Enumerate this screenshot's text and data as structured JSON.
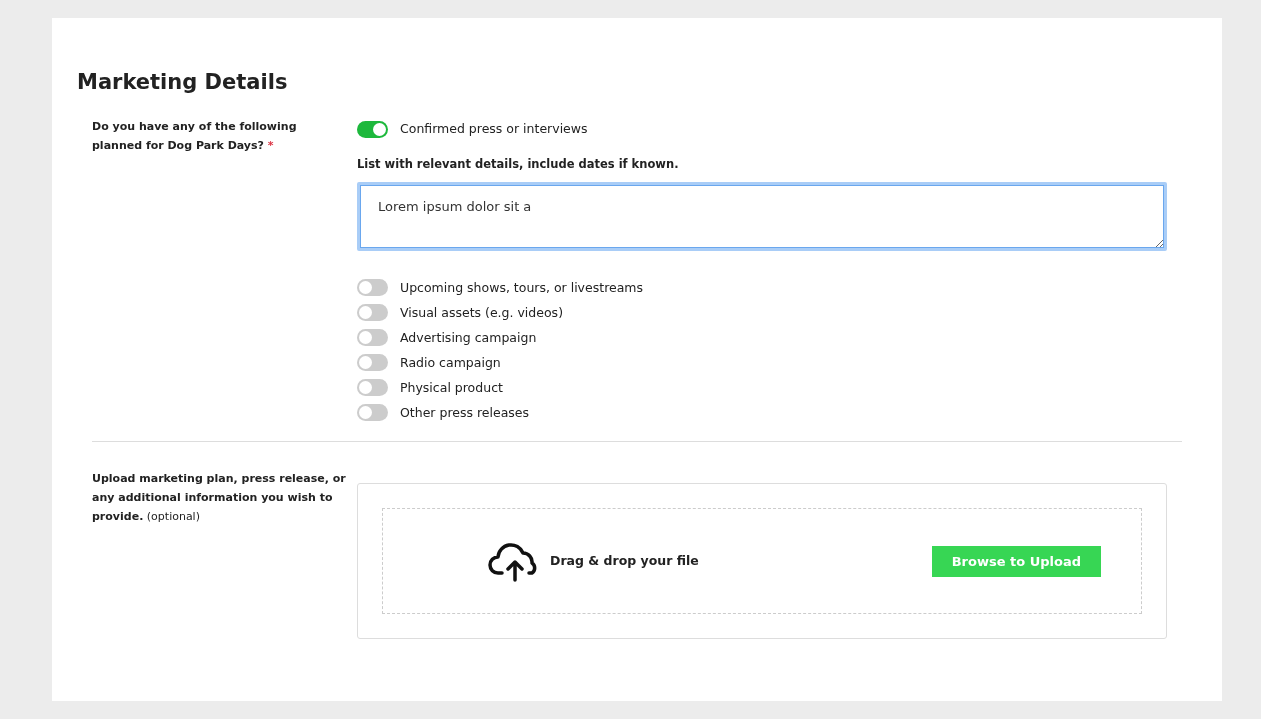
{
  "title": "Marketing Details",
  "question": {
    "label": "Do you have any of the following planned for Dog Park Days?",
    "required_mark": "*",
    "options": [
      {
        "label": "Confirmed press or interviews",
        "on": true,
        "details": {
          "label": "List with relevant details, include dates if known.",
          "value": "Lorem ipsum dolor sit a"
        }
      },
      {
        "label": "Upcoming shows, tours, or livestreams",
        "on": false
      },
      {
        "label": "Visual assets (e.g. videos)",
        "on": false
      },
      {
        "label": "Advertising campaign",
        "on": false
      },
      {
        "label": "Radio campaign",
        "on": false
      },
      {
        "label": "Physical product",
        "on": false
      },
      {
        "label": "Other press releases",
        "on": false
      }
    ]
  },
  "upload": {
    "label": "**Upload marketing plan, press release, or any additional information you wish to provide.** (optional)",
    "drop_text": "Drag & drop your file",
    "button": "Browse to Upload"
  }
}
